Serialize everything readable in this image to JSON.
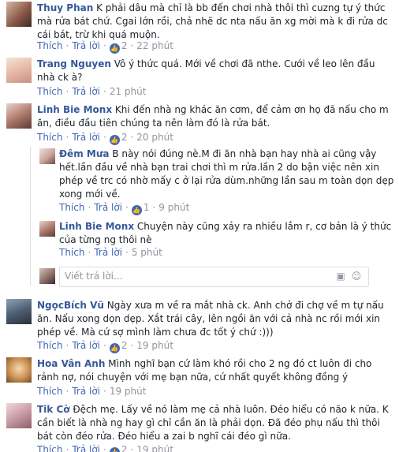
{
  "labels": {
    "like": "Thích",
    "reply": "Trả lời"
  },
  "comments": [
    {
      "name": "Thuy Phan",
      "text": "K phải dâu mà chỉ là bb đến chơi nhà thôi thì cuzng tự ý thức mà rửa bát chứ. Cgai lớn rồi, chả nhẽ dc nta nấu ăn xg mời mà k đi rửa dc cái bát, trừ khi quá muộn.",
      "likes": "2",
      "time": "22 phút"
    },
    {
      "name": "Trang Nguyen",
      "text": "Vô ý thức quá. Mới về chơi đã nthe. Cưới về leo lên đầu nhà ck à?",
      "time": "21 phút"
    },
    {
      "name": "Linh Bie Monx",
      "text": "Khi đến nhà ng khác ăn cơm, để cảm ơn họ đã nấu cho m ăn, điều đầu tiên chúng ta nên làm đó là rửa bát.",
      "likes": "2",
      "time": "20 phút"
    },
    {
      "name": "Đêm Mưa",
      "text": "B này nói đúng nè.M đi ăn nhà bạn hay nhà ai cũng vậy hết.lần đầu về nhà bạn trai chơi thì m rửa.lần 2 do bận việc nên xin phép về trc có nhờ mấy c ở lại rửa dùm.những lần sau m toàn dọn dẹp xong mới về.",
      "likes": "1",
      "time": "9 phút"
    },
    {
      "name": "Linh Bie Monx",
      "text": "Chuyện này cũng xảy ra nhiều lắm r, cơ bản là ý thức của từng ng thôi nè",
      "time": "5 phút"
    },
    {
      "name": "NgọcBích Vũ",
      "text": "Ngày xưa m về ra mắt nhà ck. Anh chở đi chợ về m tự nấu ăn. Nấu xong dọn dẹp. Xắt trái cây, lên ngồi ăn với cả nhà nc rồi mới xin phép về. Mà cứ sợ mình làm chưa đc tốt ý chứ :)))",
      "likes": "2",
      "time": "19 phút"
    },
    {
      "name": "Hoa Vân Anh",
      "text": "Mình nghĩ bạn cứ làm khó rồi cho 2 ng đó ct luôn đi cho rảnh nợ, nói chuyện với mẹ bạn nữa, cứ nhất quyết không đồng ý",
      "time": "19 phút"
    },
    {
      "name": "Tik Cờ",
      "text": "Đệch mẹ. Lấy về nó làm mẹ cả nhà luôn. Đéo hiểu có não k nữa. K cần biết là nhà ng hay gì chỉ cần ăn là phải dọn. Đã đéo phụ nấu thì thôi bát còn đéo rửa. Đéo hiểu a zai b nghĩ cái đéo gì nữa.",
      "likes": "2",
      "time": "19 phút"
    }
  ],
  "reply_box": {
    "placeholder": "Viết trả lời..."
  },
  "icons": {
    "like": "thumbs-up-icon",
    "camera": "camera-icon",
    "emoji": "smiley-icon"
  },
  "colors": {
    "name": "#365899",
    "link": "#4267b2",
    "meta": "#90949c",
    "border": "#dddfe2"
  }
}
